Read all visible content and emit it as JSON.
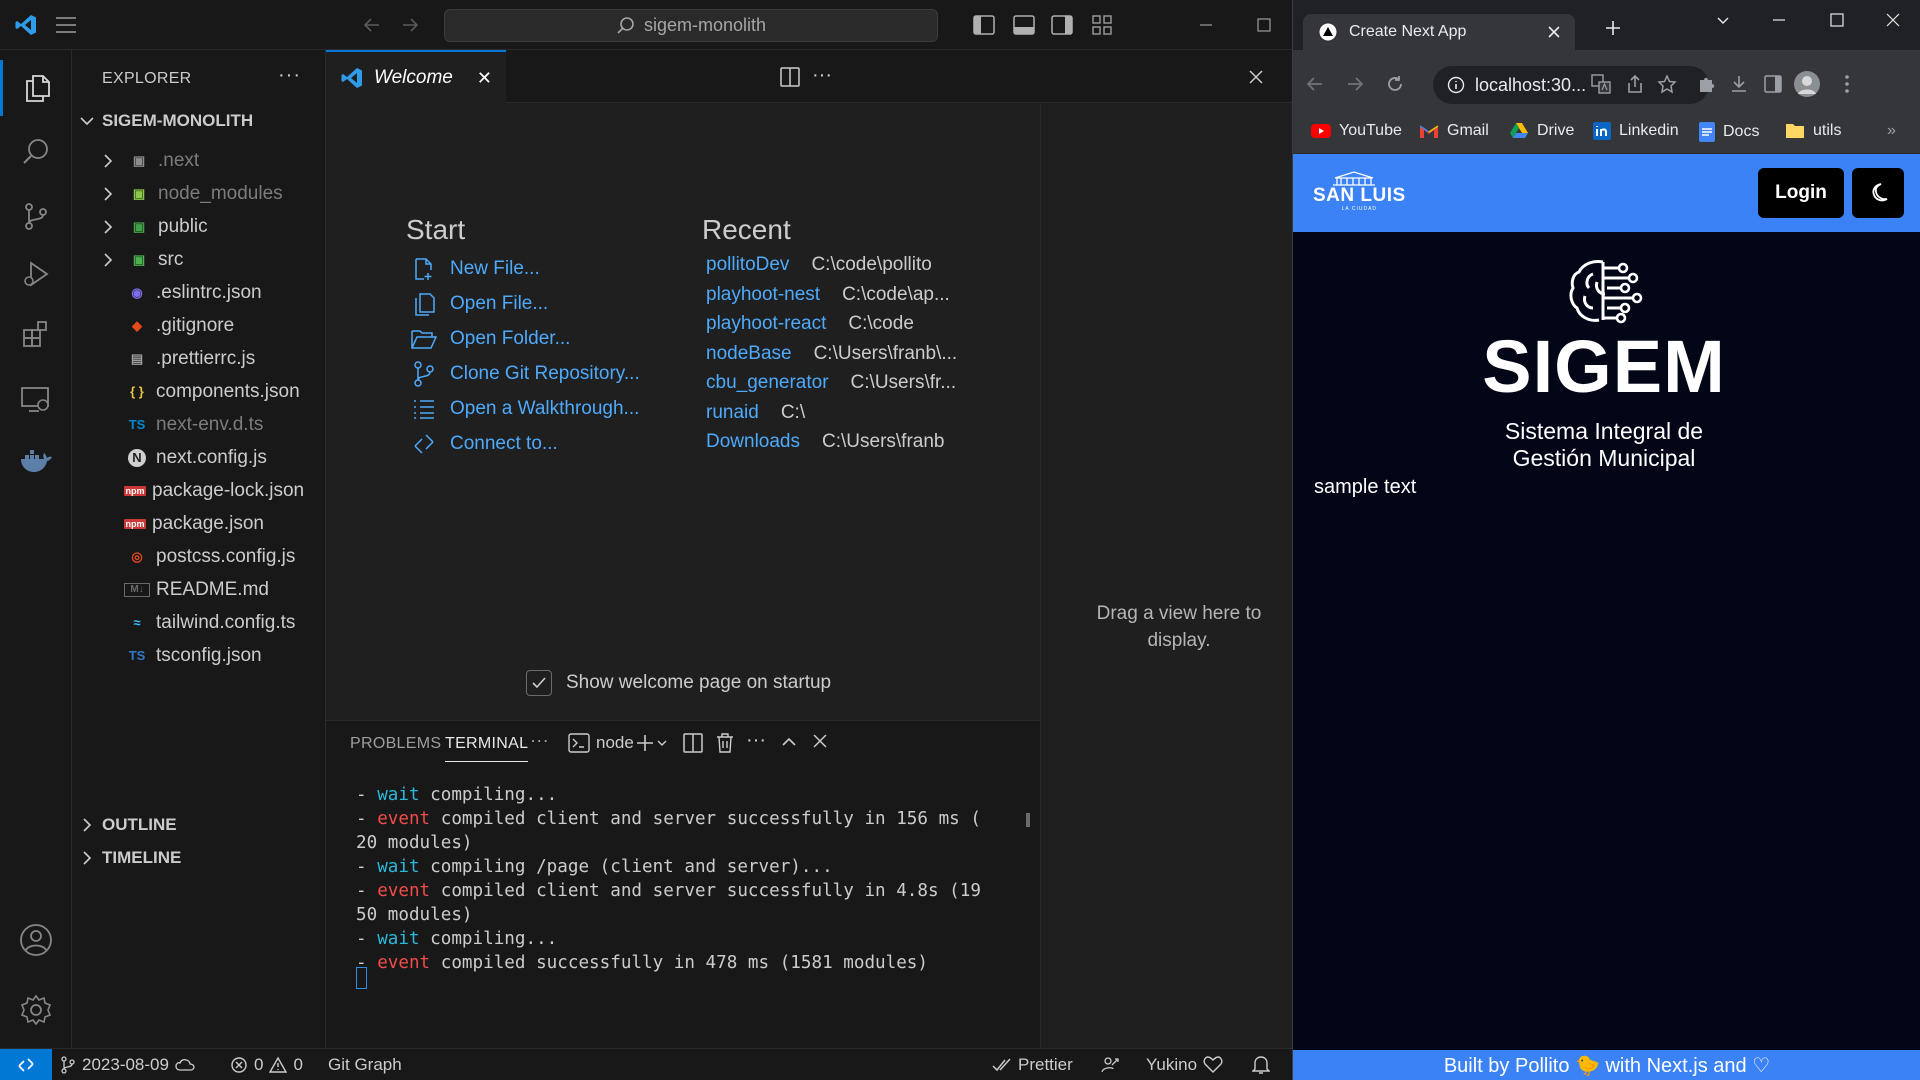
{
  "vscode": {
    "search_text": "sigem-monolith",
    "explorer": {
      "title": "EXPLORER",
      "more": "···",
      "project": "SIGEM-MONOLITH",
      "items": [
        {
          "name": ".next",
          "icon": "next-folder-icon",
          "folder": true
        },
        {
          "name": "node_modules",
          "icon": "node-folder-icon",
          "folder": true
        },
        {
          "name": "public",
          "icon": "public-folder-icon",
          "folder": true
        },
        {
          "name": "src",
          "icon": "src-folder-icon",
          "folder": true
        },
        {
          "name": ".eslintrc.json",
          "icon": "eslint-icon"
        },
        {
          "name": ".gitignore",
          "icon": "git-icon"
        },
        {
          "name": ".prettierrc.js",
          "icon": "prettier-icon"
        },
        {
          "name": "components.json",
          "icon": "json-icon",
          "glyph": "{ }"
        },
        {
          "name": "next-env.d.ts",
          "icon": "typescript-icon",
          "glyph": "TS"
        },
        {
          "name": "next.config.js",
          "icon": "next-icon",
          "glyph": "N"
        },
        {
          "name": "package-lock.json",
          "icon": "npm-icon",
          "glyph": "npm"
        },
        {
          "name": "package.json",
          "icon": "npm-icon",
          "glyph": "npm"
        },
        {
          "name": "postcss.config.js",
          "icon": "postcss-icon"
        },
        {
          "name": "README.md",
          "icon": "markdown-icon",
          "glyph": "M↓"
        },
        {
          "name": "tailwind.config.ts",
          "icon": "tailwind-icon",
          "glyph": "≈"
        },
        {
          "name": "tsconfig.json",
          "icon": "tsconfig-icon",
          "glyph": "TS"
        }
      ],
      "outline": "OUTLINE",
      "timeline": "TIMELINE"
    },
    "tab": {
      "label": "Welcome",
      "close": "✕"
    },
    "welcome": {
      "start_title": "Start",
      "start_items": [
        {
          "label": "New File...",
          "icon": "new-file-icon"
        },
        {
          "label": "Open File...",
          "icon": "open-file-icon"
        },
        {
          "label": "Open Folder...",
          "icon": "open-folder-icon"
        },
        {
          "label": "Clone Git Repository...",
          "icon": "git-clone-icon"
        },
        {
          "label": "Open a Walkthrough...",
          "icon": "walkthrough-icon"
        },
        {
          "label": "Connect to...",
          "icon": "remote-connect-icon"
        }
      ],
      "recent_title": "Recent",
      "recent_items": [
        {
          "name": "pollitoDev",
          "path": "C:\\code\\pollito"
        },
        {
          "name": "playhoot-nest",
          "path": "C:\\code\\ap..."
        },
        {
          "name": "playhoot-react",
          "path": "C:\\code"
        },
        {
          "name": "nodeBase",
          "path": "C:\\Users\\franb\\..."
        },
        {
          "name": "cbu_generator",
          "path": "C:\\Users\\fr..."
        },
        {
          "name": "runaid",
          "path": "C:\\"
        },
        {
          "name": "Downloads",
          "path": "C:\\Users\\franb"
        }
      ],
      "show_on_startup": "Show welcome page on startup",
      "show_on_startup_checked": true
    },
    "drag_view_text": "Drag a view here to display.",
    "panel": {
      "tabs": [
        "PROBLEMS",
        "TERMINAL"
      ],
      "active_tab": "TERMINAL",
      "more": "···",
      "terminal_name": "node",
      "terminal_lines": [
        {
          "kw": "wait",
          "text": " compiling..."
        },
        {
          "kw": "event",
          "text": " compiled client and server successfully in 156 ms ("
        },
        {
          "kw": "",
          "text": "20 modules)"
        },
        {
          "kw": "wait",
          "text": " compiling /page (client and server)..."
        },
        {
          "kw": "event",
          "text": " compiled client and server successfully in 4.8s (19"
        },
        {
          "kw": "",
          "text": "50 modules)"
        },
        {
          "kw": "wait",
          "text": " compiling..."
        },
        {
          "kw": "event",
          "text": " compiled successfully in 478 ms (1581 modules)"
        }
      ]
    },
    "statusbar": {
      "branch": "2023-08-09",
      "errors": "0",
      "warnings": "0",
      "git_graph": "Git Graph",
      "prettier": "Prettier",
      "theme": "Yukino"
    },
    "accent": "#0078d4"
  },
  "browser": {
    "tab_title": "Create Next App",
    "url": "localhost:30...",
    "bookmarks": [
      {
        "label": "YouTube",
        "icon": "youtube-icon"
      },
      {
        "label": "Gmail",
        "icon": "gmail-icon"
      },
      {
        "label": "Drive",
        "icon": "drive-icon"
      },
      {
        "label": "Linkedin",
        "icon": "linkedin-icon"
      },
      {
        "label": "Docs",
        "icon": "docs-icon"
      },
      {
        "label": "utils",
        "icon": "folder-icon"
      }
    ],
    "page": {
      "logo_text": "SAN LUIS",
      "logo_subtext": "LA CIUDAD",
      "login_label": "Login",
      "title": "SIGEM",
      "subtitle_line1": "Sistema Integral de",
      "subtitle_line2": "Gestión Municipal",
      "sample_text": "sample text",
      "footer_text": "Built by Pollito 🐤 with Next.js and ♡",
      "header_color": "#3b82f6",
      "background_color": "#020617"
    }
  }
}
